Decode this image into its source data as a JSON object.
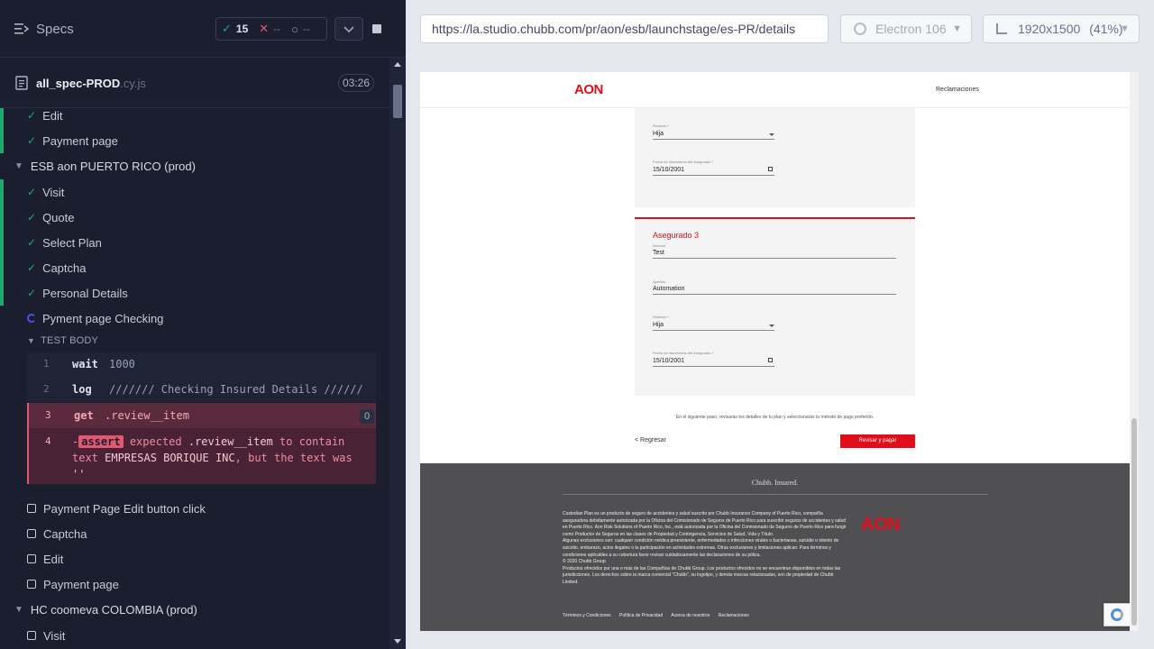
{
  "reporter": {
    "title": "Specs",
    "stats": {
      "passed_icon": "✓",
      "passed": "15",
      "failed_icon": "✕",
      "failed": "--",
      "pending_icon": "○",
      "pending": "--"
    },
    "spec_file": {
      "name": "all_spec-PROD",
      "ext": ".cy.js",
      "duration": "03:26"
    },
    "items": [
      {
        "label": "Edit"
      },
      {
        "label": "Payment page"
      },
      {
        "label": "ESB aon PUERTO RICO (prod)"
      },
      {
        "label": "Visit"
      },
      {
        "label": "Quote"
      },
      {
        "label": "Select Plan"
      },
      {
        "label": "Captcha"
      },
      {
        "label": "Personal Details"
      },
      {
        "label": "Pyment page Checking"
      },
      {
        "label": "Payment Page Edit button click"
      },
      {
        "label": "Captcha"
      },
      {
        "label": "Edit"
      },
      {
        "label": "Payment page"
      },
      {
        "label": "HC coomeva COLOMBIA (prod)"
      },
      {
        "label": "Visit"
      }
    ],
    "test_body_label": "TEST BODY",
    "commands": [
      {
        "num": "1",
        "name": "wait",
        "message": "1000"
      },
      {
        "num": "2",
        "name": "log",
        "message": "/////// Checking Insured Details //////"
      },
      {
        "num": "3",
        "name": "get",
        "message": ".review__item",
        "count": "0"
      },
      {
        "num": "4",
        "prefix": "-",
        "name": "assert",
        "message_a": "expected",
        "selector": ".review__item",
        "message_b": "to contain text",
        "expected_text": "EMPRESAS BORIQUE INC",
        "message_c": ", but the text was",
        "actual_text": "''"
      }
    ]
  },
  "aut": {
    "url": "https://la.studio.chubb.com/pr/aon/esb/launchstage/es-PR/details",
    "browser": "Electron 106",
    "viewport": "1920x1500",
    "zoom": "(41%)"
  },
  "site": {
    "logo": "AON",
    "header_link": "Reclamaciones",
    "card_top": {
      "relation_label": "Relación *",
      "relation_value": "Hija",
      "dob_label": "Fecha de Nacimiento del Asegurado *",
      "dob_value": "15/10/2001"
    },
    "insured": {
      "title": "Asegurado 3",
      "name_label": "Nombre",
      "name_value": "Test",
      "surname_label": "Apellido",
      "surname_value": "Automation",
      "relation_label": "Relación *",
      "relation_value": "Hija",
      "dob_label": "Fecha de Nacimiento del Asegurado *",
      "dob_value": "15/10/2001"
    },
    "next_step": "En el siguiente paso, revisarás los detalles de tu plan y seleccionarás tu método de pago preferido.",
    "back": "< Regresar",
    "continue": "Revisar y pagar",
    "footer": {
      "brand": "Chubb. Insured.",
      "paragraphs": [
        "Custodian Plan es un producto de seguro de accidentes y salud suscrito por Chubb Insurance Company of Puerto Rico, compañía aseguradora debidamente autorizada por la Oficina del Comisionado de Seguros de Puerto Rico para suscribir seguros de accidentes y salud en Puerto Rico. Aon Risk Solutions of Puerto Rico, Inc., está autorizada por la Oficina del Comisionado de Seguros de Puerto Rico para fungir como Productor de Seguros en las clases de Propiedad y Contingencia, Servicios de Salud, Vida y Título.",
        "Algunas exclusiones son: cualquier condición médica preexistente, enfermedades o infecciones virales o bacterianas, suicidio o intento de suicidio, embarazo, actos ilegales o la participación en actividades extremas. Otras exclusiones y limitaciones aplican. Para términos y condiciones aplicables a su cobertura favor revisar cuidadosamente las declaraciones de su póliza.",
        "© 2020 Chubb Group.",
        "Productos ofrecidos por una o más de las Compañías de Chubb Group. Los productos ofrecidos no se encuentran disponibles en todas las jurisdicciones. Los derechos sobre la marca comercial \"Chubb\", su logotipo, y demás marcas relacionadas, son de propiedad de Chubb Limited."
      ],
      "links": [
        "Términos y Condiciones",
        "Política de Privacidad",
        "Acerca de nosotros",
        "Reclamaciones"
      ]
    }
  },
  "colors": {
    "pass": "#1fa971",
    "fail": "#e45770",
    "brand_red": "#e00d1b",
    "pending": "#4956e3"
  }
}
